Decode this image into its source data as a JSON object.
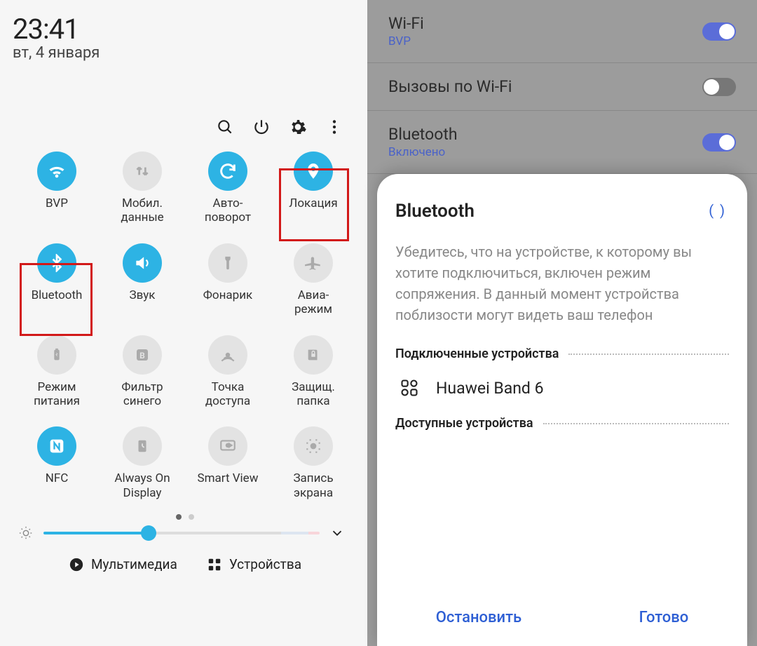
{
  "left": {
    "time": "23:41",
    "date": "вт, 4 января",
    "toolbar_icons": [
      "search",
      "power",
      "settings",
      "more"
    ],
    "tiles": [
      {
        "label": "BVP",
        "on": true,
        "icon": "wifi",
        "highlight": false
      },
      {
        "label": "Мобил.\nданные",
        "on": false,
        "icon": "data",
        "highlight": false
      },
      {
        "label": "Авто-\nповорот",
        "on": true,
        "icon": "rotate",
        "highlight": false
      },
      {
        "label": "Локация",
        "on": true,
        "icon": "location",
        "highlight": true
      },
      {
        "label": "Bluetooth",
        "on": true,
        "icon": "bluetooth",
        "highlight": true
      },
      {
        "label": "Звук",
        "on": true,
        "icon": "sound",
        "highlight": false
      },
      {
        "label": "Фонарик",
        "on": false,
        "icon": "flashlight",
        "highlight": false
      },
      {
        "label": "Авиа-\nрежим",
        "on": false,
        "icon": "airplane",
        "highlight": false
      },
      {
        "label": "Режим\nпитания",
        "on": false,
        "icon": "battery",
        "highlight": false
      },
      {
        "label": "Фильтр\nсинего",
        "on": false,
        "icon": "bluelight",
        "highlight": false
      },
      {
        "label": "Точка\nдоступа",
        "on": false,
        "icon": "hotspot",
        "highlight": false
      },
      {
        "label": "Защищ.\nпапка",
        "on": false,
        "icon": "secure",
        "highlight": false
      },
      {
        "label": "NFC",
        "on": true,
        "icon": "nfc",
        "highlight": false
      },
      {
        "label": "Always On\nDisplay",
        "on": false,
        "icon": "aod",
        "highlight": false
      },
      {
        "label": "Smart View",
        "on": false,
        "icon": "smartview",
        "highlight": false
      },
      {
        "label": "Запись\nэкрана",
        "on": false,
        "icon": "record",
        "highlight": false
      }
    ],
    "brightness_percent": 38,
    "bottom": {
      "media": "Мультимедиа",
      "devices": "Устройства"
    }
  },
  "right": {
    "rows": [
      {
        "title": "Wi-Fi",
        "sub": "BVP",
        "toggle": true
      },
      {
        "title": "Вызовы по Wi-Fi",
        "sub": "",
        "toggle": false
      },
      {
        "title": "Bluetooth",
        "sub": "Включено",
        "toggle": true
      }
    ],
    "sheet": {
      "title": "Bluetooth",
      "spinner": "(   )",
      "hint": "Убедитесь, что на устройстве, к которому вы хотите подключиться, включен режим сопряжения. В данный момент устройства поблизости могут видеть ваш телефон",
      "connected_section": "Подключенные устройства",
      "device_name": "Huawei Band 6",
      "available_section": "Доступные устройства",
      "action_stop": "Остановить",
      "action_done": "Готово"
    }
  }
}
